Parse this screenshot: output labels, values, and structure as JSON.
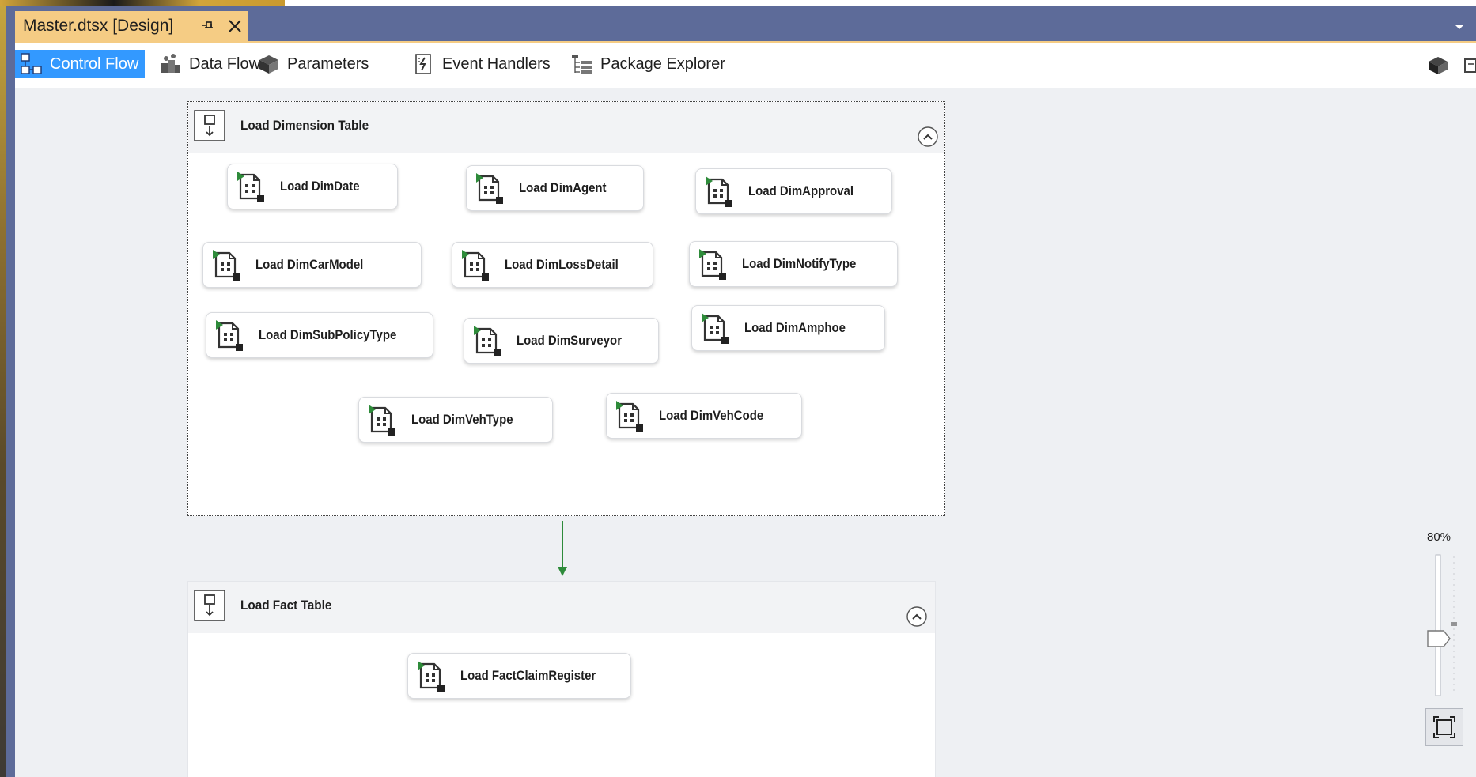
{
  "document_tab": {
    "title": "Master.dtsx [Design]"
  },
  "designer_tabs": [
    {
      "label": "Control Flow",
      "icon": "control-flow-icon",
      "active": true
    },
    {
      "label": "Data Flow",
      "icon": "data-flow-icon",
      "active": false
    },
    {
      "label": "Parameters",
      "icon": "parameters-icon",
      "active": false
    },
    {
      "label": "Event Handlers",
      "icon": "event-handlers-icon",
      "active": false
    },
    {
      "label": "Package Explorer",
      "icon": "package-explorer-icon",
      "active": false
    }
  ],
  "containers": {
    "dimension": {
      "title": "Load Dimension Table",
      "tasks": [
        {
          "label": "Load DimDate"
        },
        {
          "label": "Load DimAgent"
        },
        {
          "label": "Load DimApproval"
        },
        {
          "label": "Load DimCarModel"
        },
        {
          "label": "Load DimLossDetail"
        },
        {
          "label": "Load DimNotifyType"
        },
        {
          "label": "Load DimSubPolicyType"
        },
        {
          "label": "Load DimSurveyor"
        },
        {
          "label": "Load DimAmphoe"
        },
        {
          "label": "Load DimVehType"
        },
        {
          "label": "Load DimVehCode"
        }
      ]
    },
    "fact": {
      "title": "Load Fact Table",
      "tasks": [
        {
          "label": "Load FactClaimRegister"
        }
      ]
    }
  },
  "zoom": {
    "label": "80%",
    "value_percent": 80
  },
  "colors": {
    "title_bar": "#5d6b99",
    "active_doc_tab": "#f5cc84",
    "active_designer_tab": "#3399ff",
    "canvas": "#eef0f3",
    "precedence_success": "#2e8b3a",
    "task_icon_green": "#2e8b3a"
  }
}
